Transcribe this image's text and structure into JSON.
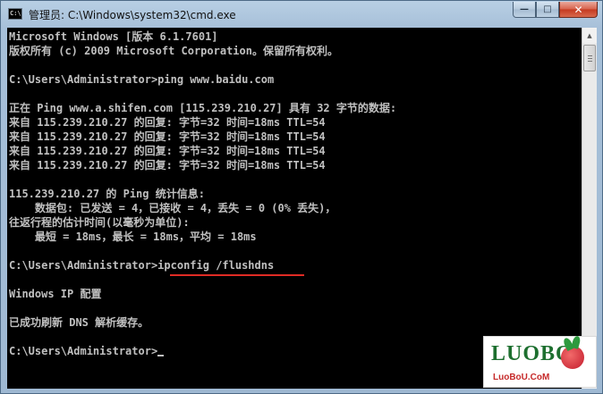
{
  "window": {
    "title": "管理员: C:\\Windows\\system32\\cmd.exe",
    "icon_text": "C:\\"
  },
  "controls": {
    "minimize": "—",
    "maximize": "□",
    "close": "✕"
  },
  "console": {
    "lines": [
      "Microsoft Windows [版本 6.1.7601]",
      "版权所有 (c) 2009 Microsoft Corporation。保留所有权利。",
      "",
      "C:\\Users\\Administrator>ping www.baidu.com",
      "",
      "正在 Ping www.a.shifen.com [115.239.210.27] 具有 32 字节的数据:",
      "来自 115.239.210.27 的回复: 字节=32 时间=18ms TTL=54",
      "来自 115.239.210.27 的回复: 字节=32 时间=18ms TTL=54",
      "来自 115.239.210.27 的回复: 字节=32 时间=18ms TTL=54",
      "来自 115.239.210.27 的回复: 字节=32 时间=18ms TTL=54",
      "",
      "115.239.210.27 的 Ping 统计信息:",
      "    数据包: 已发送 = 4，已接收 = 4，丢失 = 0 (0% 丢失)，",
      "往返行程的估计时间(以毫秒为单位):",
      "    最短 = 18ms，最长 = 18ms，平均 = 18ms",
      "",
      "C:\\Users\\Administrator>ipconfig /flushdns",
      "",
      "Windows IP 配置",
      "",
      "已成功刷新 DNS 解析缓存。",
      "",
      "C:\\Users\\Administrator>"
    ]
  },
  "watermark": {
    "logo": "LUOBO",
    "site": "LuoBoU.CoM"
  },
  "colors": {
    "highlight_underline": "#e02b25",
    "console_text": "#c0c0c0",
    "console_bg": "#000000"
  }
}
